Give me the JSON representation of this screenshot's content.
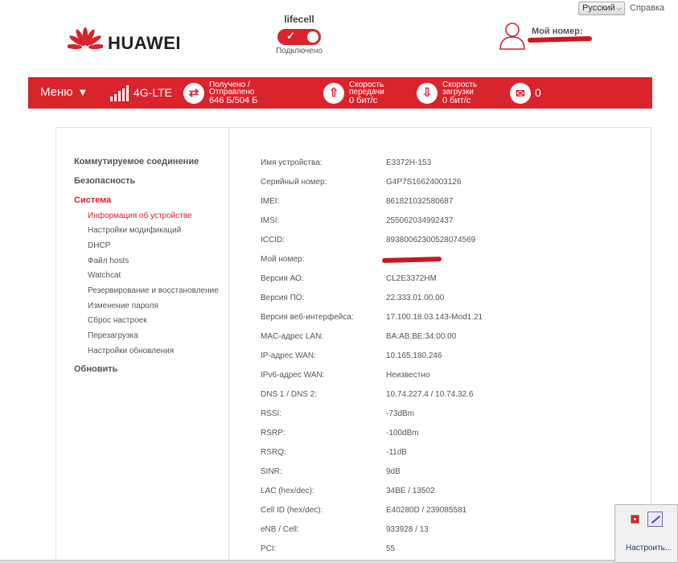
{
  "topbar": {
    "language": "Русский",
    "help": "Справка"
  },
  "brand": {
    "name": "HUAWEI",
    "color": "#d9232d"
  },
  "operator": {
    "name": "lifecell",
    "status": "Подключено",
    "toggle_on": true
  },
  "user": {
    "label": "Мой номер:"
  },
  "statusbar": {
    "menu": "Меню",
    "network_type": "4G-LTE",
    "traffic_label_1": "Получено /",
    "traffic_label_2": "Отправлено",
    "traffic_value": "646 Б/504 Б",
    "upload_label_1": "Скорость",
    "upload_label_2": "передачи",
    "upload_value": "0 бит/с",
    "download_label_1": "Скорость",
    "download_label_2": "загрузки",
    "download_value": "0 бит/с",
    "messages_count": "0",
    "icons": {
      "signal": "signal-bars-icon",
      "traffic": "transfer-arrows-icon",
      "upload": "arrow-up-icon",
      "download": "arrow-down-icon",
      "messages": "envelope-icon"
    }
  },
  "sidebar": {
    "dialup": "Коммутируемое соединение",
    "security": "Безопасность",
    "system": "Система",
    "items": [
      "Информация об устройстве",
      "Настройки модификаций",
      "DHCP",
      "Файл hosts",
      "Watchcat",
      "Резервирование и восстановление",
      "Изменение пароля",
      "Сброс настроек",
      "Перезагрузка",
      "Настройки обновления"
    ],
    "update": "Обновить"
  },
  "device_info": [
    {
      "label": "Имя устройства:",
      "value": "E3372H-153"
    },
    {
      "label": "Серийный номер:",
      "value": "G4P7S16624003126"
    },
    {
      "label": "IMEI:",
      "value": "861821032580687"
    },
    {
      "label": "IMSI:",
      "value": "255062034992437"
    },
    {
      "label": "ICCID:",
      "value": "89380062300528074569"
    },
    {
      "label": "Мой номер:",
      "value": ""
    },
    {
      "label": "Версия АО:",
      "value": "CL2E3372HM"
    },
    {
      "label": "Версия ПО:",
      "value": "22.333.01.00.00"
    },
    {
      "label": "Версия веб-интерфейса:",
      "value": "17.100.18.03.143-Mod1.21"
    },
    {
      "label": "MAC-адрес LAN:",
      "value": "BA:AB:BE:34:00:00"
    },
    {
      "label": "IP-адрес WAN:",
      "value": "10.165.180.246"
    },
    {
      "label": "IPv6-адрес WAN:",
      "value": "Неизвестно"
    },
    {
      "label": "DNS 1 / DNS 2:",
      "value": "10.74.227.4 / 10.74.32.6"
    },
    {
      "label": "RSSI:",
      "value": "-73dBm"
    },
    {
      "label": "RSRP:",
      "value": "-100dBm"
    },
    {
      "label": "RSRQ:",
      "value": "-11dB"
    },
    {
      "label": "SINR:",
      "value": "9dB"
    },
    {
      "label": "LAC (hex/dec):",
      "value": "34BE / 13502"
    },
    {
      "label": "Cell ID (hex/dec):",
      "value": "E40280D / 239085581"
    },
    {
      "label": "eNB / Cell:",
      "value": "933928 / 13"
    },
    {
      "label": "PCI:",
      "value": "55"
    }
  ],
  "tray": {
    "link": "Настроить..."
  }
}
